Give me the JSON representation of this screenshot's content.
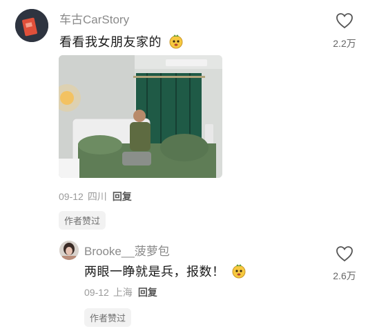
{
  "comment": {
    "username": "车古CarStory",
    "text": "看看我女朋友家的",
    "emoji_icon": "sticker-face-icon",
    "likes": "2.2万",
    "date": "09-12",
    "location": "四川",
    "reply_label": "回复",
    "badge": "作者赞过",
    "photo_icon": "bedroom-photo"
  },
  "reply": {
    "username": "Brooke__菠萝包",
    "text": "两眼一睁就是兵，报数！",
    "emoji_icon": "sticker-face-icon",
    "likes": "2.6万",
    "date": "09-12",
    "location": "上海",
    "reply_label": "回复",
    "badge": "作者赞过"
  },
  "colors": {
    "avatar_bg": "#2e3440",
    "avatar_accent": "#e0503a",
    "curtain": "#1f5a46",
    "bedding": "#5f7d56"
  }
}
